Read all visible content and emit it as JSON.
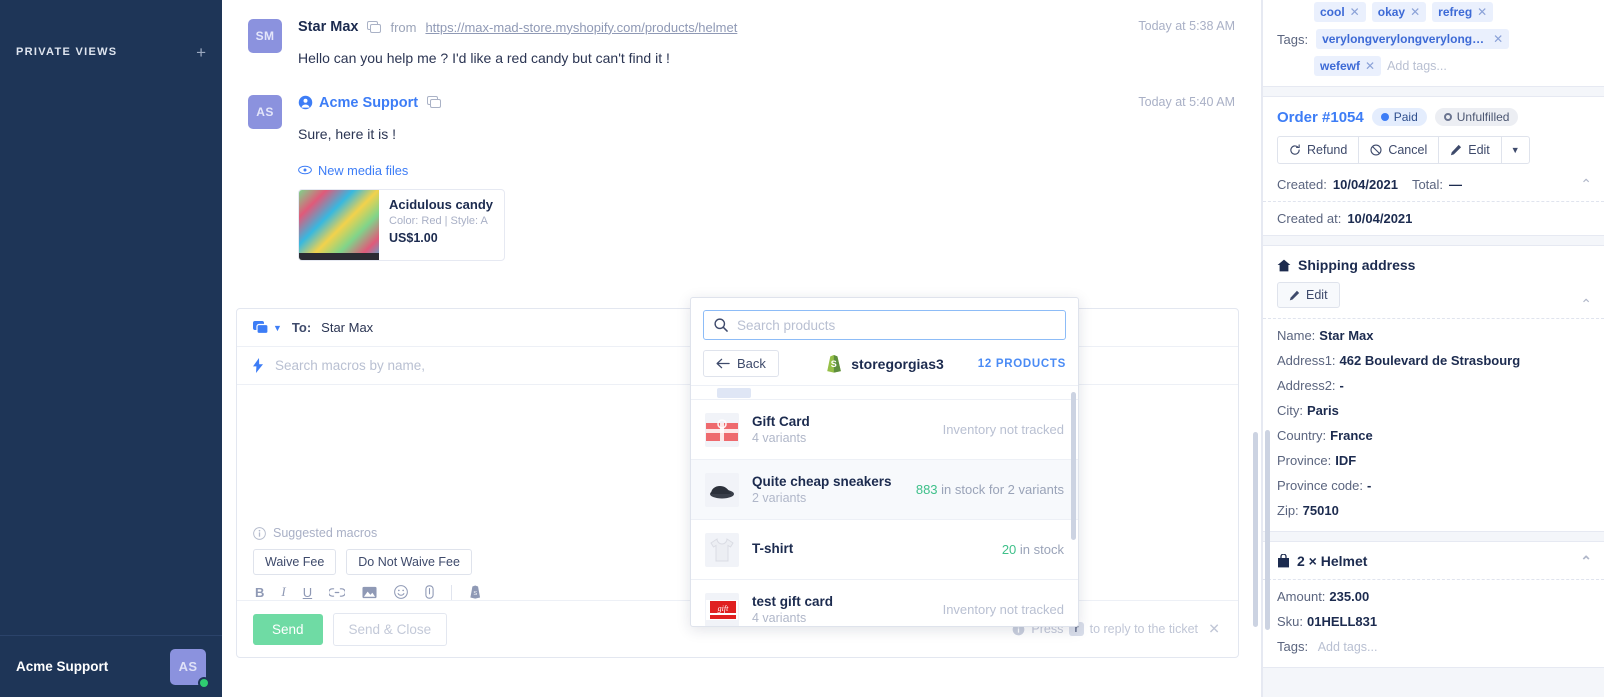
{
  "sidebar": {
    "section_label": "PRIVATE VIEWS",
    "add_icon": "+",
    "user_name": "Acme Support",
    "user_initials": "AS"
  },
  "thread": {
    "messages": [
      {
        "initials": "SM",
        "author": "Star Max",
        "from_label": "from",
        "source_url": "https://max-mad-store.myshopify.com/products/helmet",
        "text": "Hello can you help me ? I'd like a red candy but can't find it !",
        "time": "Today at 5:38 AM"
      },
      {
        "initials": "AS",
        "author": "Acme Support",
        "text": "Sure, here it is !",
        "time": "Today at 5:40 AM",
        "media_label": "New media files",
        "attachment": {
          "title": "Acidulous candy",
          "meta": "Color: Red | Style: A",
          "price": "US$1.00"
        }
      }
    ]
  },
  "composer": {
    "to_label": "To:",
    "to_value": "Star Max",
    "macro_placeholder": "Search macros by name,",
    "suggested_label": "Suggested macros",
    "macro_chips": [
      "Waive Fee",
      "Do Not Waive Fee"
    ],
    "format_buttons": [
      "B",
      "I",
      "U",
      "link-icon",
      "image-icon",
      "emoji-icon",
      "attachment-icon",
      "shopify-icon"
    ],
    "send_label": "Send",
    "send_close_label": "Send & Close",
    "hint_prefix": "Press",
    "hint_key": "r",
    "hint_suffix": "to reply to the ticket"
  },
  "product_popup": {
    "search_placeholder": "Search products",
    "search_value": "",
    "back_label": "Back",
    "store_name": "storegorgias3",
    "product_count_label": "12 PRODUCTS",
    "products": [
      {
        "title": "Gift Card",
        "subtitle": "4 variants",
        "stock_text": "Inventory not tracked",
        "stock_num": "",
        "tracked": false,
        "highlighted": false,
        "thumb": "giftcard-red"
      },
      {
        "title": "Quite cheap sneakers",
        "subtitle": "2 variants",
        "stock_num": "883",
        "stock_text": "in stock for 2 variants",
        "tracked": true,
        "highlighted": true,
        "thumb": "sneaker"
      },
      {
        "title": "T-shirt",
        "subtitle": "",
        "stock_num": "20",
        "stock_text": "in stock",
        "tracked": true,
        "highlighted": false,
        "thumb": "tshirt"
      },
      {
        "title": "test gift card",
        "subtitle": "4 variants",
        "stock_text": "Inventory not tracked",
        "stock_num": "",
        "tracked": false,
        "highlighted": false,
        "thumb": "giftcard-dark"
      }
    ]
  },
  "right_panel": {
    "tags_row_top": [
      {
        "label": "cool"
      },
      {
        "label": "okay"
      },
      {
        "label": "refreg"
      }
    ],
    "tags_label": "Tags:",
    "tag_long": "verylongverylongverylongverylongver...",
    "tag_short": "wefewf",
    "tags_placeholder": "Add tags...",
    "order": {
      "number": "Order #1054",
      "status_paid": "Paid",
      "status_fulfillment": "Unfulfilled",
      "actions": [
        "Refund",
        "Cancel",
        "Edit"
      ],
      "created_label": "Created:",
      "created_value": "10/04/2021",
      "total_label": "Total:",
      "total_value": "—",
      "created_at_label": "Created at:",
      "created_at_value": "10/04/2021"
    },
    "shipping": {
      "title": "Shipping address",
      "edit_label": "Edit",
      "fields": [
        {
          "label": "Name:",
          "value": "Star Max"
        },
        {
          "label": "Address1:",
          "value": "462 Boulevard de Strasbourg"
        },
        {
          "label": "Address2:",
          "value": "-"
        },
        {
          "label": "City:",
          "value": "Paris"
        },
        {
          "label": "Country:",
          "value": "France"
        },
        {
          "label": "Province:",
          "value": "IDF"
        },
        {
          "label": "Province code:",
          "value": "-"
        },
        {
          "label": "Zip:",
          "value": "75010"
        }
      ]
    },
    "line_item": {
      "title": "2 × Helmet",
      "fields": [
        {
          "label": "Amount:",
          "value": "235.00"
        },
        {
          "label": "Sku:",
          "value": "01HELL831"
        }
      ],
      "tags_label": "Tags:",
      "tags_placeholder": "Add tags..."
    }
  },
  "colors": {
    "sidebar_bg": "#1e3557",
    "accent_blue": "#3d7df6",
    "send_green": "#6fdba4",
    "stock_green": "#3fc08a",
    "avatar_purple": "#8b92de"
  }
}
